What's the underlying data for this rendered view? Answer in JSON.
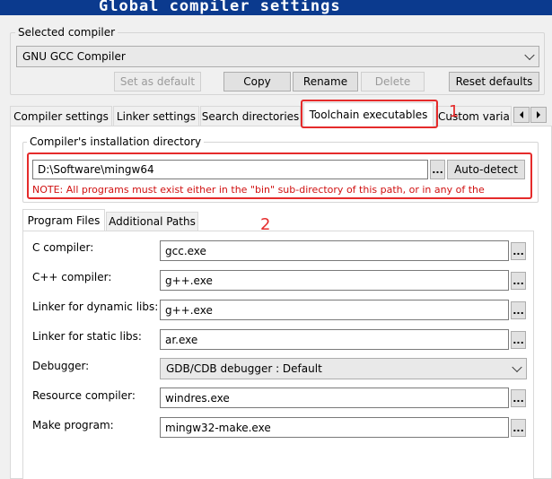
{
  "window": {
    "title": "Global compiler settings"
  },
  "selected_compiler": {
    "legend": "Selected compiler",
    "value": "GNU GCC Compiler",
    "buttons": {
      "set_default": "Set as default",
      "copy": "Copy",
      "rename": "Rename",
      "delete": "Delete",
      "reset": "Reset defaults"
    }
  },
  "tabs": [
    "Compiler settings",
    "Linker settings",
    "Search directories",
    "Toolchain executables",
    "Custom variab"
  ],
  "install_dir": {
    "legend": "Compiler's installation directory",
    "path": "D:\\Software\\mingw64",
    "browse": "...",
    "auto_detect": "Auto-detect",
    "note": "NOTE: All programs must exist either in the \"bin\" sub-directory of this path, or in any of the"
  },
  "subtabs": [
    "Program Files",
    "Additional Paths"
  ],
  "programs": [
    {
      "label": "C compiler:",
      "value": "gcc.exe",
      "kind": "input"
    },
    {
      "label": "C++ compiler:",
      "value": "g++.exe",
      "kind": "input"
    },
    {
      "label": "Linker for dynamic libs:",
      "value": "g++.exe",
      "kind": "input"
    },
    {
      "label": "Linker for static libs:",
      "value": "ar.exe",
      "kind": "input"
    },
    {
      "label": "Debugger:",
      "value": "GDB/CDB debugger : Default",
      "kind": "select"
    },
    {
      "label": "Resource compiler:",
      "value": "windres.exe",
      "kind": "input"
    },
    {
      "label": "Make program:",
      "value": "mingw32-make.exe",
      "kind": "input"
    }
  ],
  "browse_label": "...",
  "annotations": {
    "one": "1",
    "two": "2"
  },
  "colors": {
    "titlebar": "#0b3a8e",
    "highlight": "#e52b2b",
    "note": "#d01010"
  }
}
